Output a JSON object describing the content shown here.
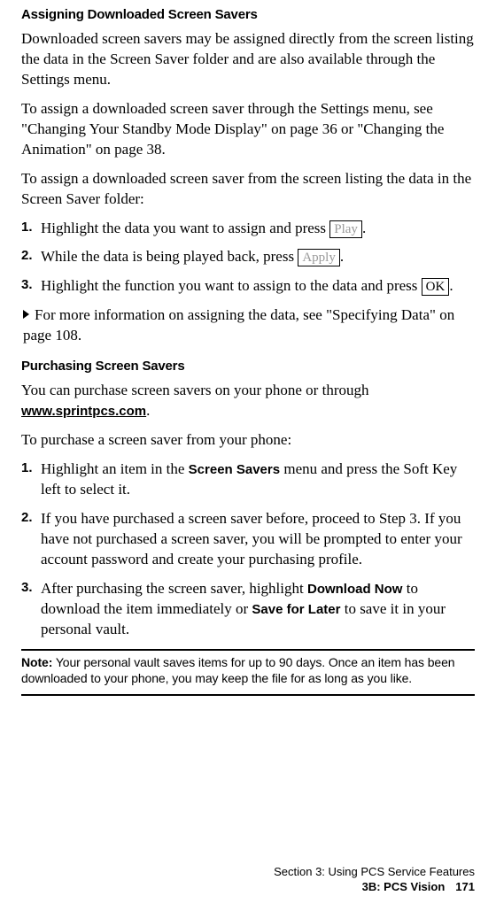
{
  "heading1": "Assigning Downloaded Screen Savers",
  "p1": "Downloaded screen savers may be assigned directly from the screen listing the data in the Screen Saver folder and are also available through the Settings menu.",
  "p2": "To assign a downloaded screen saver through the Settings menu, see \"Changing Your Standby Mode Display\" on page 36 or \"Changing the Animation\" on page 38.",
  "p3": "To assign a downloaded screen saver from the screen listing the data in the Screen Saver folder:",
  "s1": {
    "num": "1.",
    "pre": "Highlight the data you want to assign and press ",
    "key": "Play",
    "post": "."
  },
  "s2": {
    "num": "2.",
    "pre": "While the data is being played back, press ",
    "key": "Apply",
    "post": "."
  },
  "s3": {
    "num": "3.",
    "pre": "Highlight the function you want to assign to the data and press ",
    "key": "OK",
    "post": "."
  },
  "bullet1": "For more information on assigning the data, see \"Specifying Data\" on page 108.",
  "heading2": "Purchasing Screen Savers",
  "p4_pre": "You can purchase screen savers on your phone or through ",
  "p4_url": "www.sprintpcs.com",
  "p4_post": ".",
  "p5": "To purchase a screen saver from your phone:",
  "b1": {
    "num": "1.",
    "pre": "Highlight an item in the ",
    "bold1": "Screen Savers",
    "post": " menu and press the Soft Key left to select it."
  },
  "b2": {
    "num": "2.",
    "text": "If you have purchased a screen saver before, proceed to Step 3. If you have not purchased a screen saver, you will be prompted to enter your account password and create your purchasing profile."
  },
  "b3": {
    "num": "3.",
    "pre": "After purchasing the screen saver, highlight ",
    "bold1": "Download Now",
    "mid": " to download the item immediately or ",
    "bold2": "Save for Later",
    "post": " to save it in your personal vault."
  },
  "note": {
    "label": "Note:",
    "text": " Your personal vault saves items for up to 90 days. Once an item has been downloaded to your phone, you may keep the file for as long as you like."
  },
  "footer": {
    "line1": "Section 3: Using PCS Service Features",
    "line2": "3B: PCS Vision",
    "page": "171"
  }
}
